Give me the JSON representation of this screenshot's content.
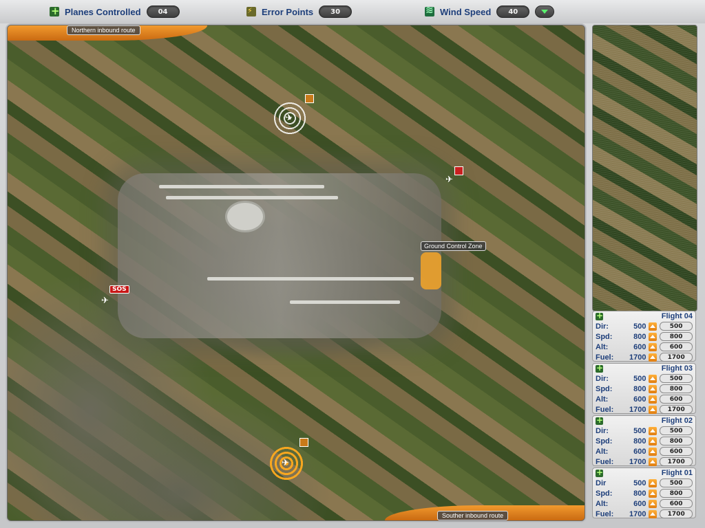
{
  "stats": {
    "planes_controlled_label": "Planes Controlled",
    "planes_controlled_value": "04",
    "error_points_label": "Error Points",
    "error_points_value": "30",
    "wind_speed_label": "Wind Speed",
    "wind_speed_value": "40"
  },
  "map": {
    "northern_route": "Northern inbound route",
    "southern_route": "Souther inbound route",
    "ground_control_zone": "Ground Control Zone",
    "sos_marker": "SOS"
  },
  "icons": [
    "plus-icon",
    "error-icon",
    "wind-icon",
    "chevron-down-icon",
    "plane-icon",
    "flag-icon",
    "up-arrow-icon"
  ],
  "colors": {
    "accent_orange": "#f29a2e",
    "label_blue": "#1d3e7a",
    "sos_red": "#c81616"
  },
  "flights": [
    {
      "title": "Flight 04",
      "rows": [
        {
          "label": "Dir:",
          "value": "500",
          "input": "500"
        },
        {
          "label": "Spd:",
          "value": "800",
          "input": "800"
        },
        {
          "label": "Alt:",
          "value": "600",
          "input": "600"
        },
        {
          "label": "Fuel:",
          "value": "1700",
          "input": "1700"
        }
      ]
    },
    {
      "title": "Flight 03",
      "rows": [
        {
          "label": "Dir:",
          "value": "500",
          "input": "500"
        },
        {
          "label": "Spd:",
          "value": "800",
          "input": "800"
        },
        {
          "label": "Alt:",
          "value": "600",
          "input": "600"
        },
        {
          "label": "Fuel:",
          "value": "1700",
          "input": "1700"
        }
      ]
    },
    {
      "title": "Flight 02",
      "rows": [
        {
          "label": "Dir:",
          "value": "500",
          "input": "500"
        },
        {
          "label": "Spd:",
          "value": "800",
          "input": "800"
        },
        {
          "label": "Alt:",
          "value": "600",
          "input": "600"
        },
        {
          "label": "Fuel:",
          "value": "1700",
          "input": "1700"
        }
      ]
    },
    {
      "title": "Flight 01",
      "rows": [
        {
          "label": "Dir",
          "value": "500",
          "input": "500"
        },
        {
          "label": "Spd:",
          "value": "800",
          "input": "800"
        },
        {
          "label": "Alt:",
          "value": "600",
          "input": "600"
        },
        {
          "label": "Fuel:",
          "value": "1700",
          "input": "1700"
        }
      ]
    }
  ]
}
